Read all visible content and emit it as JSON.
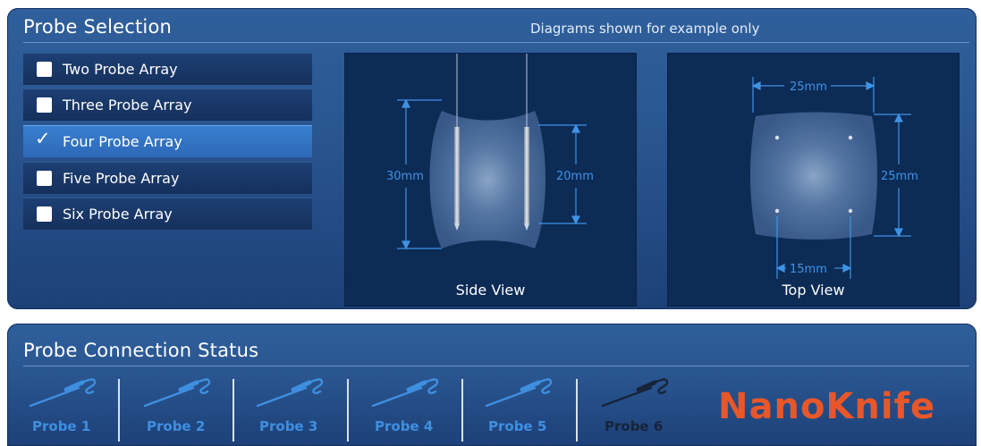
{
  "selection": {
    "title": "Probe Selection",
    "note": "Diagrams shown for example only",
    "options": [
      {
        "label": "Two Probe Array",
        "checked": false
      },
      {
        "label": "Three Probe Array",
        "checked": false
      },
      {
        "label": "Four Probe Array",
        "checked": true
      },
      {
        "label": "Five Probe Array",
        "checked": false
      },
      {
        "label": "Six Probe Array",
        "checked": false
      }
    ],
    "side_view": {
      "caption": "Side View",
      "dim_left": "30mm",
      "dim_right": "20mm"
    },
    "top_view": {
      "caption": "Top View",
      "dim_top": "25mm",
      "dim_right": "25mm",
      "dim_bottom": "15mm"
    }
  },
  "connection": {
    "title": "Probe Connection Status",
    "probes": [
      {
        "label": "Probe 1",
        "connected": true
      },
      {
        "label": "Probe 2",
        "connected": true
      },
      {
        "label": "Probe 3",
        "connected": true
      },
      {
        "label": "Probe 4",
        "connected": true
      },
      {
        "label": "Probe 5",
        "connected": true
      },
      {
        "label": "Probe 6",
        "connected": false
      }
    ],
    "logo": "NanoKnife"
  },
  "colors": {
    "accent_blue": "#3f8fe0",
    "logo_orange": "#e8572a",
    "disconnected": "#16243a"
  }
}
